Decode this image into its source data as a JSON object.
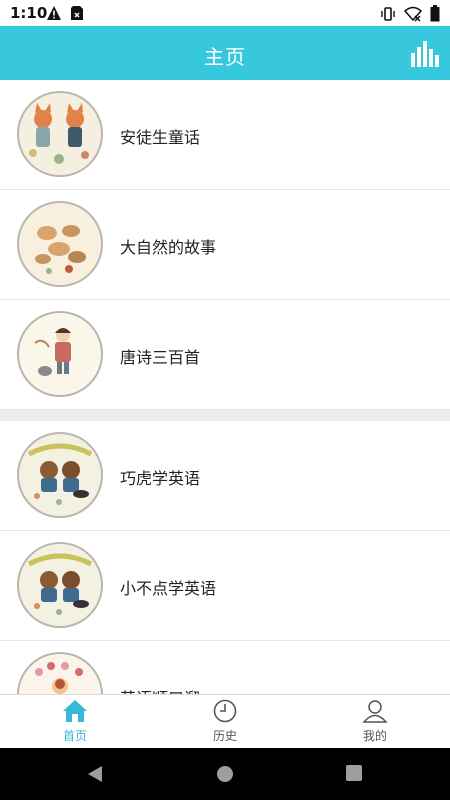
{
  "status_bar": {
    "time": "1:10",
    "icons": [
      "alert-icon",
      "sim-icon",
      "vibrate-icon",
      "wifi-off-icon",
      "battery-icon"
    ]
  },
  "app_bar": {
    "title": "主页",
    "action_icon": "equalizer-icon"
  },
  "sections": [
    {
      "items": [
        {
          "label": "安徒生童话",
          "thumb": "fox-illustration"
        },
        {
          "label": "大自然的故事",
          "thumb": "squirrel-illustration"
        },
        {
          "label": "唐诗三百首",
          "thumb": "child-illustration"
        }
      ]
    },
    {
      "items": [
        {
          "label": "巧虎学英语",
          "thumb": "bear-illustration"
        },
        {
          "label": "小不点学英语",
          "thumb": "bear-illustration"
        },
        {
          "label": "英语顺口溜",
          "thumb": "flower-illustration"
        }
      ]
    }
  ],
  "bottom_nav": {
    "tabs": [
      {
        "label": "首页",
        "icon": "home-icon",
        "active": true
      },
      {
        "label": "历史",
        "icon": "clock-icon",
        "active": false
      },
      {
        "label": "我的",
        "icon": "person-icon",
        "active": false
      }
    ]
  },
  "colors": {
    "accent": "#37c8dd",
    "active_tab": "#36b8d6"
  }
}
